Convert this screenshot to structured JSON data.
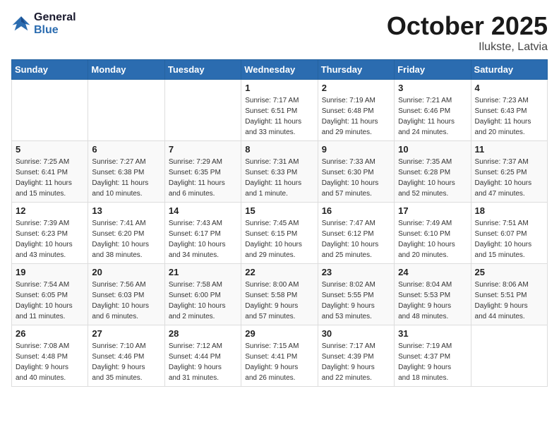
{
  "header": {
    "logo_line1": "General",
    "logo_line2": "Blue",
    "month": "October 2025",
    "location": "Ilukste, Latvia"
  },
  "weekdays": [
    "Sunday",
    "Monday",
    "Tuesday",
    "Wednesday",
    "Thursday",
    "Friday",
    "Saturday"
  ],
  "weeks": [
    [
      {
        "day": "",
        "info": ""
      },
      {
        "day": "",
        "info": ""
      },
      {
        "day": "",
        "info": ""
      },
      {
        "day": "1",
        "info": "Sunrise: 7:17 AM\nSunset: 6:51 PM\nDaylight: 11 hours\nand 33 minutes."
      },
      {
        "day": "2",
        "info": "Sunrise: 7:19 AM\nSunset: 6:48 PM\nDaylight: 11 hours\nand 29 minutes."
      },
      {
        "day": "3",
        "info": "Sunrise: 7:21 AM\nSunset: 6:46 PM\nDaylight: 11 hours\nand 24 minutes."
      },
      {
        "day": "4",
        "info": "Sunrise: 7:23 AM\nSunset: 6:43 PM\nDaylight: 11 hours\nand 20 minutes."
      }
    ],
    [
      {
        "day": "5",
        "info": "Sunrise: 7:25 AM\nSunset: 6:41 PM\nDaylight: 11 hours\nand 15 minutes."
      },
      {
        "day": "6",
        "info": "Sunrise: 7:27 AM\nSunset: 6:38 PM\nDaylight: 11 hours\nand 10 minutes."
      },
      {
        "day": "7",
        "info": "Sunrise: 7:29 AM\nSunset: 6:35 PM\nDaylight: 11 hours\nand 6 minutes."
      },
      {
        "day": "8",
        "info": "Sunrise: 7:31 AM\nSunset: 6:33 PM\nDaylight: 11 hours\nand 1 minute."
      },
      {
        "day": "9",
        "info": "Sunrise: 7:33 AM\nSunset: 6:30 PM\nDaylight: 10 hours\nand 57 minutes."
      },
      {
        "day": "10",
        "info": "Sunrise: 7:35 AM\nSunset: 6:28 PM\nDaylight: 10 hours\nand 52 minutes."
      },
      {
        "day": "11",
        "info": "Sunrise: 7:37 AM\nSunset: 6:25 PM\nDaylight: 10 hours\nand 47 minutes."
      }
    ],
    [
      {
        "day": "12",
        "info": "Sunrise: 7:39 AM\nSunset: 6:23 PM\nDaylight: 10 hours\nand 43 minutes."
      },
      {
        "day": "13",
        "info": "Sunrise: 7:41 AM\nSunset: 6:20 PM\nDaylight: 10 hours\nand 38 minutes."
      },
      {
        "day": "14",
        "info": "Sunrise: 7:43 AM\nSunset: 6:17 PM\nDaylight: 10 hours\nand 34 minutes."
      },
      {
        "day": "15",
        "info": "Sunrise: 7:45 AM\nSunset: 6:15 PM\nDaylight: 10 hours\nand 29 minutes."
      },
      {
        "day": "16",
        "info": "Sunrise: 7:47 AM\nSunset: 6:12 PM\nDaylight: 10 hours\nand 25 minutes."
      },
      {
        "day": "17",
        "info": "Sunrise: 7:49 AM\nSunset: 6:10 PM\nDaylight: 10 hours\nand 20 minutes."
      },
      {
        "day": "18",
        "info": "Sunrise: 7:51 AM\nSunset: 6:07 PM\nDaylight: 10 hours\nand 15 minutes."
      }
    ],
    [
      {
        "day": "19",
        "info": "Sunrise: 7:54 AM\nSunset: 6:05 PM\nDaylight: 10 hours\nand 11 minutes."
      },
      {
        "day": "20",
        "info": "Sunrise: 7:56 AM\nSunset: 6:03 PM\nDaylight: 10 hours\nand 6 minutes."
      },
      {
        "day": "21",
        "info": "Sunrise: 7:58 AM\nSunset: 6:00 PM\nDaylight: 10 hours\nand 2 minutes."
      },
      {
        "day": "22",
        "info": "Sunrise: 8:00 AM\nSunset: 5:58 PM\nDaylight: 9 hours\nand 57 minutes."
      },
      {
        "day": "23",
        "info": "Sunrise: 8:02 AM\nSunset: 5:55 PM\nDaylight: 9 hours\nand 53 minutes."
      },
      {
        "day": "24",
        "info": "Sunrise: 8:04 AM\nSunset: 5:53 PM\nDaylight: 9 hours\nand 48 minutes."
      },
      {
        "day": "25",
        "info": "Sunrise: 8:06 AM\nSunset: 5:51 PM\nDaylight: 9 hours\nand 44 minutes."
      }
    ],
    [
      {
        "day": "26",
        "info": "Sunrise: 7:08 AM\nSunset: 4:48 PM\nDaylight: 9 hours\nand 40 minutes."
      },
      {
        "day": "27",
        "info": "Sunrise: 7:10 AM\nSunset: 4:46 PM\nDaylight: 9 hours\nand 35 minutes."
      },
      {
        "day": "28",
        "info": "Sunrise: 7:12 AM\nSunset: 4:44 PM\nDaylight: 9 hours\nand 31 minutes."
      },
      {
        "day": "29",
        "info": "Sunrise: 7:15 AM\nSunset: 4:41 PM\nDaylight: 9 hours\nand 26 minutes."
      },
      {
        "day": "30",
        "info": "Sunrise: 7:17 AM\nSunset: 4:39 PM\nDaylight: 9 hours\nand 22 minutes."
      },
      {
        "day": "31",
        "info": "Sunrise: 7:19 AM\nSunset: 4:37 PM\nDaylight: 9 hours\nand 18 minutes."
      },
      {
        "day": "",
        "info": ""
      }
    ]
  ]
}
